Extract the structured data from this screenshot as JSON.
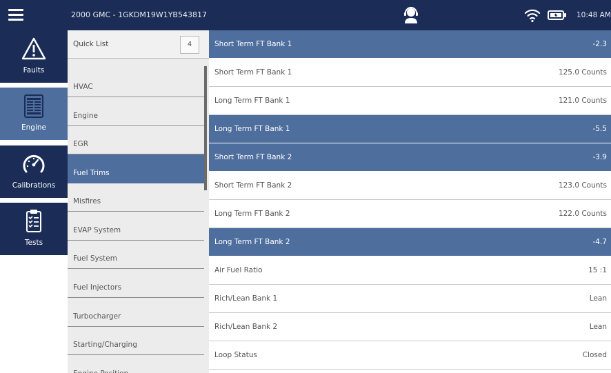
{
  "topbar": {
    "vehicle": "2000 GMC - 1GKDM19W1YB543817",
    "time": "10:48 AM",
    "menu_icon": "hamburger-menu-icon",
    "support_icon": "headset-agent-icon",
    "wifi_icon": "wifi-icon",
    "battery_icon": "battery-icon"
  },
  "nav": [
    {
      "label": "Faults",
      "icon": "warning-triangle-icon"
    },
    {
      "label": "Engine",
      "icon": "engine-data-list-icon",
      "active": true
    },
    {
      "label": "Calibrations",
      "icon": "gauge-icon"
    },
    {
      "label": "Tests",
      "icon": "clipboard-checklist-icon"
    }
  ],
  "categories": {
    "quick_list": {
      "label": "Quick List",
      "count": "4"
    },
    "items": [
      {
        "label": "HVAC"
      },
      {
        "label": "Engine"
      },
      {
        "label": "EGR"
      },
      {
        "label": "Fuel Trims",
        "active": true
      },
      {
        "label": "Misfires"
      },
      {
        "label": "EVAP System"
      },
      {
        "label": "Fuel System"
      },
      {
        "label": "Fuel Injectors"
      },
      {
        "label": "Turbocharger"
      },
      {
        "label": "Starting/Charging"
      },
      {
        "label": "Engine Position"
      }
    ]
  },
  "parameters": [
    {
      "name": "Short Term FT Bank 1",
      "value": "-2.3",
      "highlighted": true
    },
    {
      "name": "Short Term FT Bank 1",
      "value": "125.0 Counts",
      "highlighted": false
    },
    {
      "name": "Long Term FT Bank 1",
      "value": "121.0 Counts",
      "highlighted": false
    },
    {
      "name": "Long Term FT Bank 1",
      "value": "-5.5",
      "highlighted": true
    },
    {
      "name": "Short Term FT Bank 2",
      "value": "-3.9",
      "highlighted": true
    },
    {
      "name": "Short Term FT Bank 2",
      "value": "123.0 Counts",
      "highlighted": false
    },
    {
      "name": "Long Term FT Bank 2",
      "value": "122.0 Counts",
      "highlighted": false
    },
    {
      "name": "Long Term FT Bank 2",
      "value": "-4.7",
      "highlighted": true
    },
    {
      "name": "Air Fuel Ratio",
      "value": "15 :1",
      "highlighted": false
    },
    {
      "name": "Rich/Lean Bank 1",
      "value": "Lean",
      "highlighted": false
    },
    {
      "name": "Rich/Lean Bank 2",
      "value": "Lean",
      "highlighted": false
    },
    {
      "name": "Loop Status",
      "value": "Closed",
      "highlighted": false
    }
  ],
  "colors": {
    "header": "#1b2d57",
    "highlight": "#4e6e9e",
    "panel_bg": "#ececec"
  }
}
